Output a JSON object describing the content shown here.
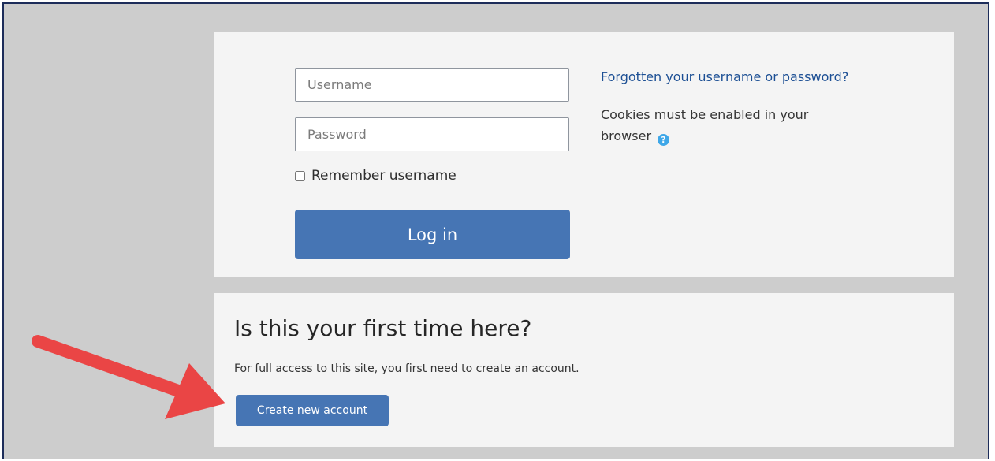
{
  "login": {
    "username_placeholder": "Username",
    "password_placeholder": "Password",
    "remember_label": "Remember username",
    "login_button": "Log in",
    "forgot_link": "Forgotten your username or password?",
    "cookies_notice": "Cookies must be enabled in your browser"
  },
  "signup": {
    "title": "Is this your first time here?",
    "description": "For full access to this site, you first need to create an account.",
    "create_button": "Create new account"
  },
  "colors": {
    "primary_button": "#4675b4",
    "link": "#1c4f94",
    "help_icon": "#3ea7e8",
    "annotation_arrow": "#ea4545",
    "page_background": "#cdcdcd",
    "card_background": "#f4f4f4"
  },
  "icons": {
    "help": "question-circle-icon",
    "annotation": "red-arrow-annotation"
  }
}
